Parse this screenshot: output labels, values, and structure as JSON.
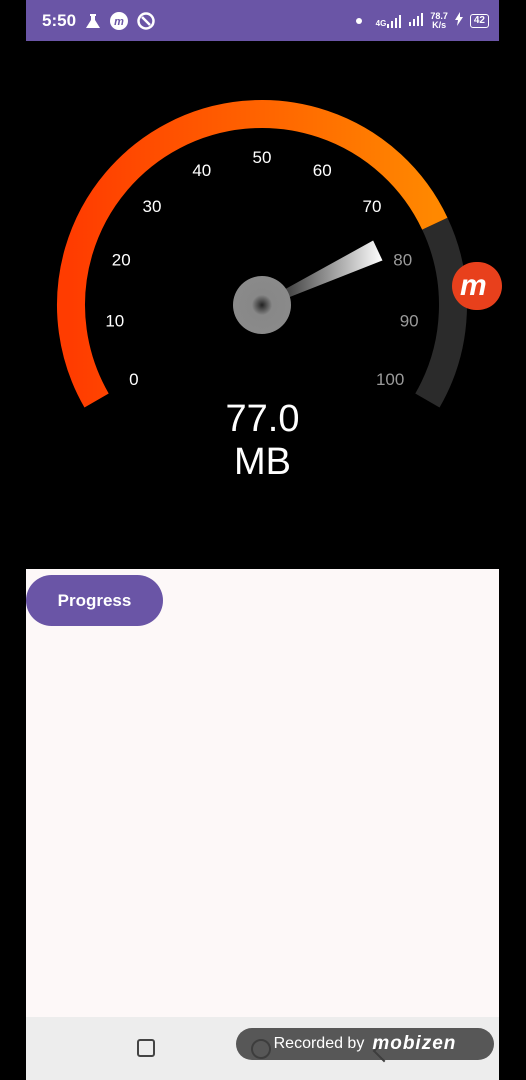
{
  "status_bar": {
    "time": "5:50",
    "net_type": "4G",
    "speed_value": "78.7",
    "speed_unit": "K/s",
    "battery": "42"
  },
  "gauge": {
    "value": 77.0,
    "value_text": "77.0",
    "unit": "MB",
    "min": 0,
    "max": 100,
    "ticks": [
      "0",
      "10",
      "20",
      "30",
      "40",
      "50",
      "60",
      "70",
      "80",
      "90",
      "100"
    ],
    "colors": {
      "arc_start": "#ff3c00",
      "arc_end": "#ff8800",
      "arc_rest": "#2b2b2b",
      "tick_active": "#ffffff",
      "tick_inactive": "#9a9a9a"
    }
  },
  "side_badge": {
    "label": "m"
  },
  "main": {
    "progress_button": "Progress"
  },
  "watermark": {
    "recorded_by": "Recorded by",
    "brand": "mobizen"
  },
  "colors": {
    "accent": "#6a55a6",
    "content_bg": "#fdf8f8"
  }
}
